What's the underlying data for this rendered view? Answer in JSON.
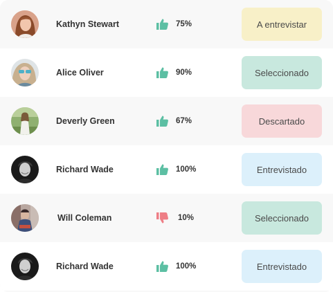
{
  "candidates": [
    {
      "name": "Kathyn Stewart",
      "score": "75%",
      "rating": "up",
      "status": "A entrevistar",
      "status_bg": "#f8f0c8"
    },
    {
      "name": "Alice Oliver",
      "score": "90%",
      "rating": "up",
      "status": "Seleccionado",
      "status_bg": "#c8e8de"
    },
    {
      "name": "Deverly Green",
      "score": "67%",
      "rating": "up",
      "status": "Descartado",
      "status_bg": "#f8d8da"
    },
    {
      "name": "Richard Wade",
      "score": "100%",
      "rating": "up",
      "status": "Entrevistado",
      "status_bg": "#dcf0fb"
    },
    {
      "name": "Will Coleman",
      "score": "10%",
      "rating": "down",
      "status": "Seleccionado",
      "status_bg": "#c8e8de"
    },
    {
      "name": "Richard Wade",
      "score": "100%",
      "rating": "up",
      "status": "Entrevistado",
      "status_bg": "#dcf0fb"
    }
  ],
  "colors": {
    "thumb_up": "#5cbfa3",
    "thumb_down": "#ee7e86"
  },
  "icons": {
    "up": "thumbs-up-icon",
    "down": "thumbs-down-icon"
  }
}
